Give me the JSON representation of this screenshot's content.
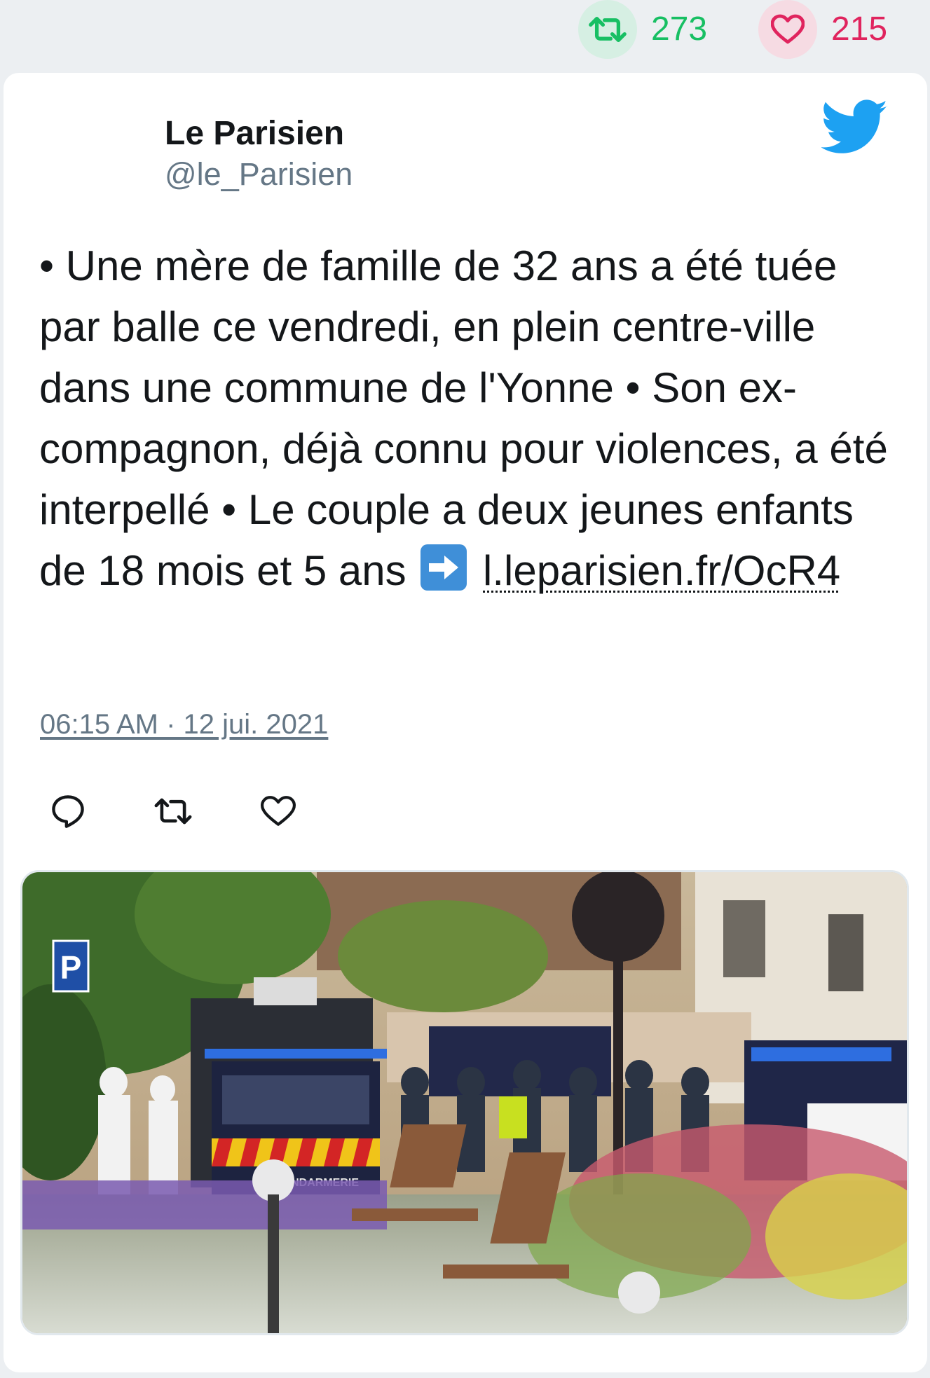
{
  "stats": {
    "retweet_count": "273",
    "like_count": "215",
    "retweet_icon": "retweet-icon",
    "like_icon": "heart-icon",
    "retweet_color": "#17bf63",
    "like_color": "#e0245e"
  },
  "tweet": {
    "author_name": "Le Parisien",
    "author_handle": "@le_Parisien",
    "text_before_link": "• Une mère de famille de 32 ans a été tuée par balle ce vendredi, en plein centre-ville dans une commune de l'Yonne • Son ex-compagnon, déjà connu pour violences, a été interpellé • Le couple a deux jeunes enfants de 18 mois et 5 ans",
    "link_text": "l.leparisien.fr/OcR4",
    "timestamp": "06:15 AM · 12 jui. 2021",
    "brand_color": "#1da1f2"
  },
  "media": {
    "parking_sign_text": "P",
    "van_label": "GENDARMERIE"
  },
  "actions": [
    {
      "name": "reply",
      "icon": "reply-icon"
    },
    {
      "name": "retweet",
      "icon": "retweet-icon"
    },
    {
      "name": "like",
      "icon": "heart-icon"
    }
  ]
}
